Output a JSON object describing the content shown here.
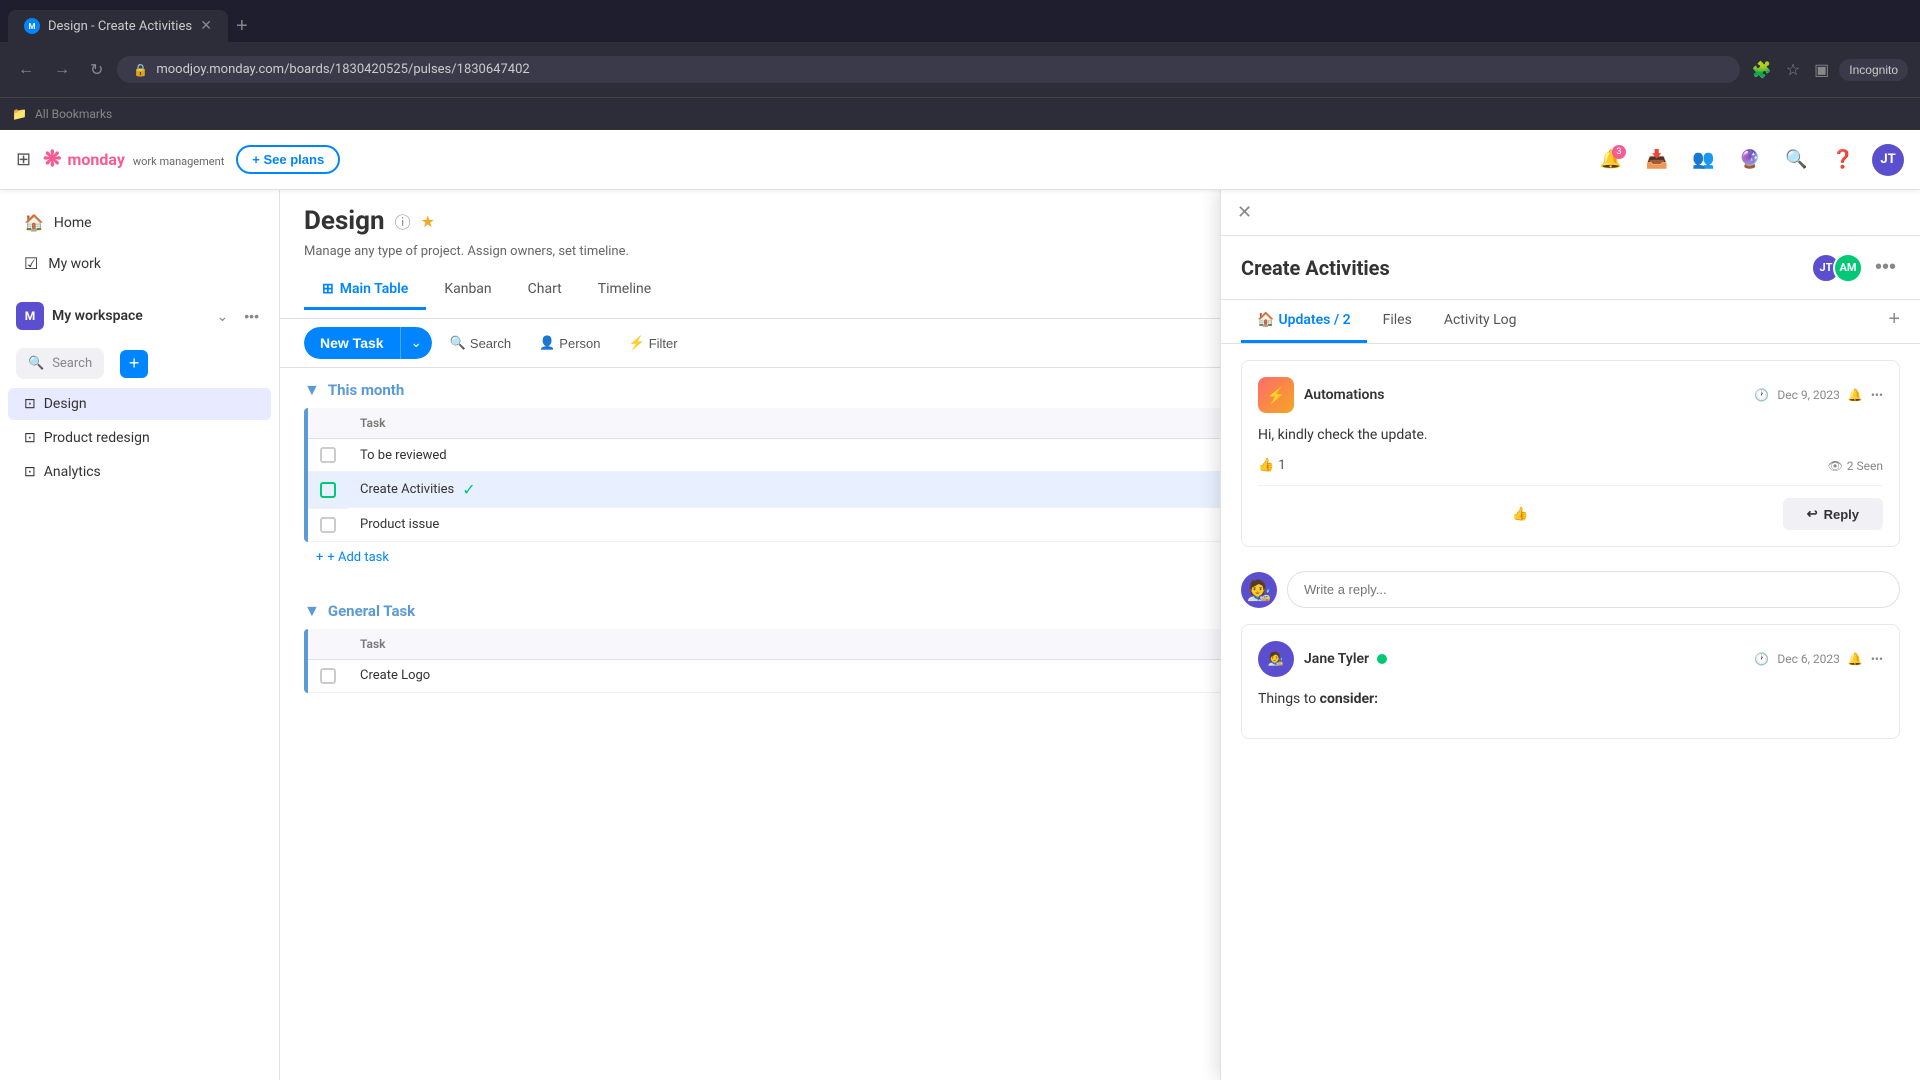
{
  "browser": {
    "tab_title": "Design - Create Activities",
    "tab_favicon": "M",
    "url": "moodjoy.monday.com/boards/1830420525/pulses/1830647402",
    "incognito_label": "Incognito",
    "bookmarks_label": "All Bookmarks"
  },
  "topnav": {
    "logo_text": "monday",
    "logo_sub": "work management",
    "see_plans_label": "+ See plans",
    "badge_count": "3"
  },
  "sidebar": {
    "home_label": "Home",
    "my_work_label": "My work",
    "workspace_label": "My workspace",
    "search_placeholder": "Search",
    "add_btn_label": "+",
    "nav_items": [
      {
        "label": "Design",
        "active": true
      },
      {
        "label": "Product redesign",
        "active": false
      },
      {
        "label": "Analytics",
        "active": false
      }
    ]
  },
  "board": {
    "title": "Design",
    "description": "Manage any type of project. Assign owners, set timeline.",
    "tabs": [
      "Main Table",
      "Kanban",
      "Chart",
      "Timeline"
    ],
    "active_tab": "Main Table",
    "new_task_label": "New Task",
    "toolbar_items": [
      "Search",
      "Person",
      "Filter"
    ]
  },
  "table": {
    "sections": [
      {
        "title": "This month",
        "color": "#5b9bd5",
        "tasks": [
          {
            "name": "To be reviewed",
            "selected": false
          },
          {
            "name": "Create Activities",
            "selected": true,
            "checked": true
          },
          {
            "name": "Product issue",
            "selected": false
          }
        ],
        "add_task_label": "+ Add task"
      },
      {
        "title": "General Task",
        "color": "#5b9bd5",
        "tasks": [
          {
            "name": "Create Logo",
            "selected": false
          }
        ]
      }
    ],
    "column_header": "Task"
  },
  "panel": {
    "title": "Create Activities",
    "tabs": [
      "Updates / 2",
      "Files",
      "Activity Log"
    ],
    "active_tab": "Updates / 2",
    "updates": [
      {
        "author": "Automations",
        "date": "Dec 9, 2023",
        "body": "Hi, kindly check the update.",
        "reaction": "👍 1",
        "seen": "2 Seen",
        "thumb_emoji": "👍",
        "reply_label": "Reply"
      },
      {
        "author": "Jane Tyler",
        "date": "Dec 6, 2023",
        "online": true,
        "body_prefix": "Things to ",
        "body_bold": "consider:",
        "body_rest": ""
      }
    ],
    "reply_placeholder": "Write a reply..."
  }
}
